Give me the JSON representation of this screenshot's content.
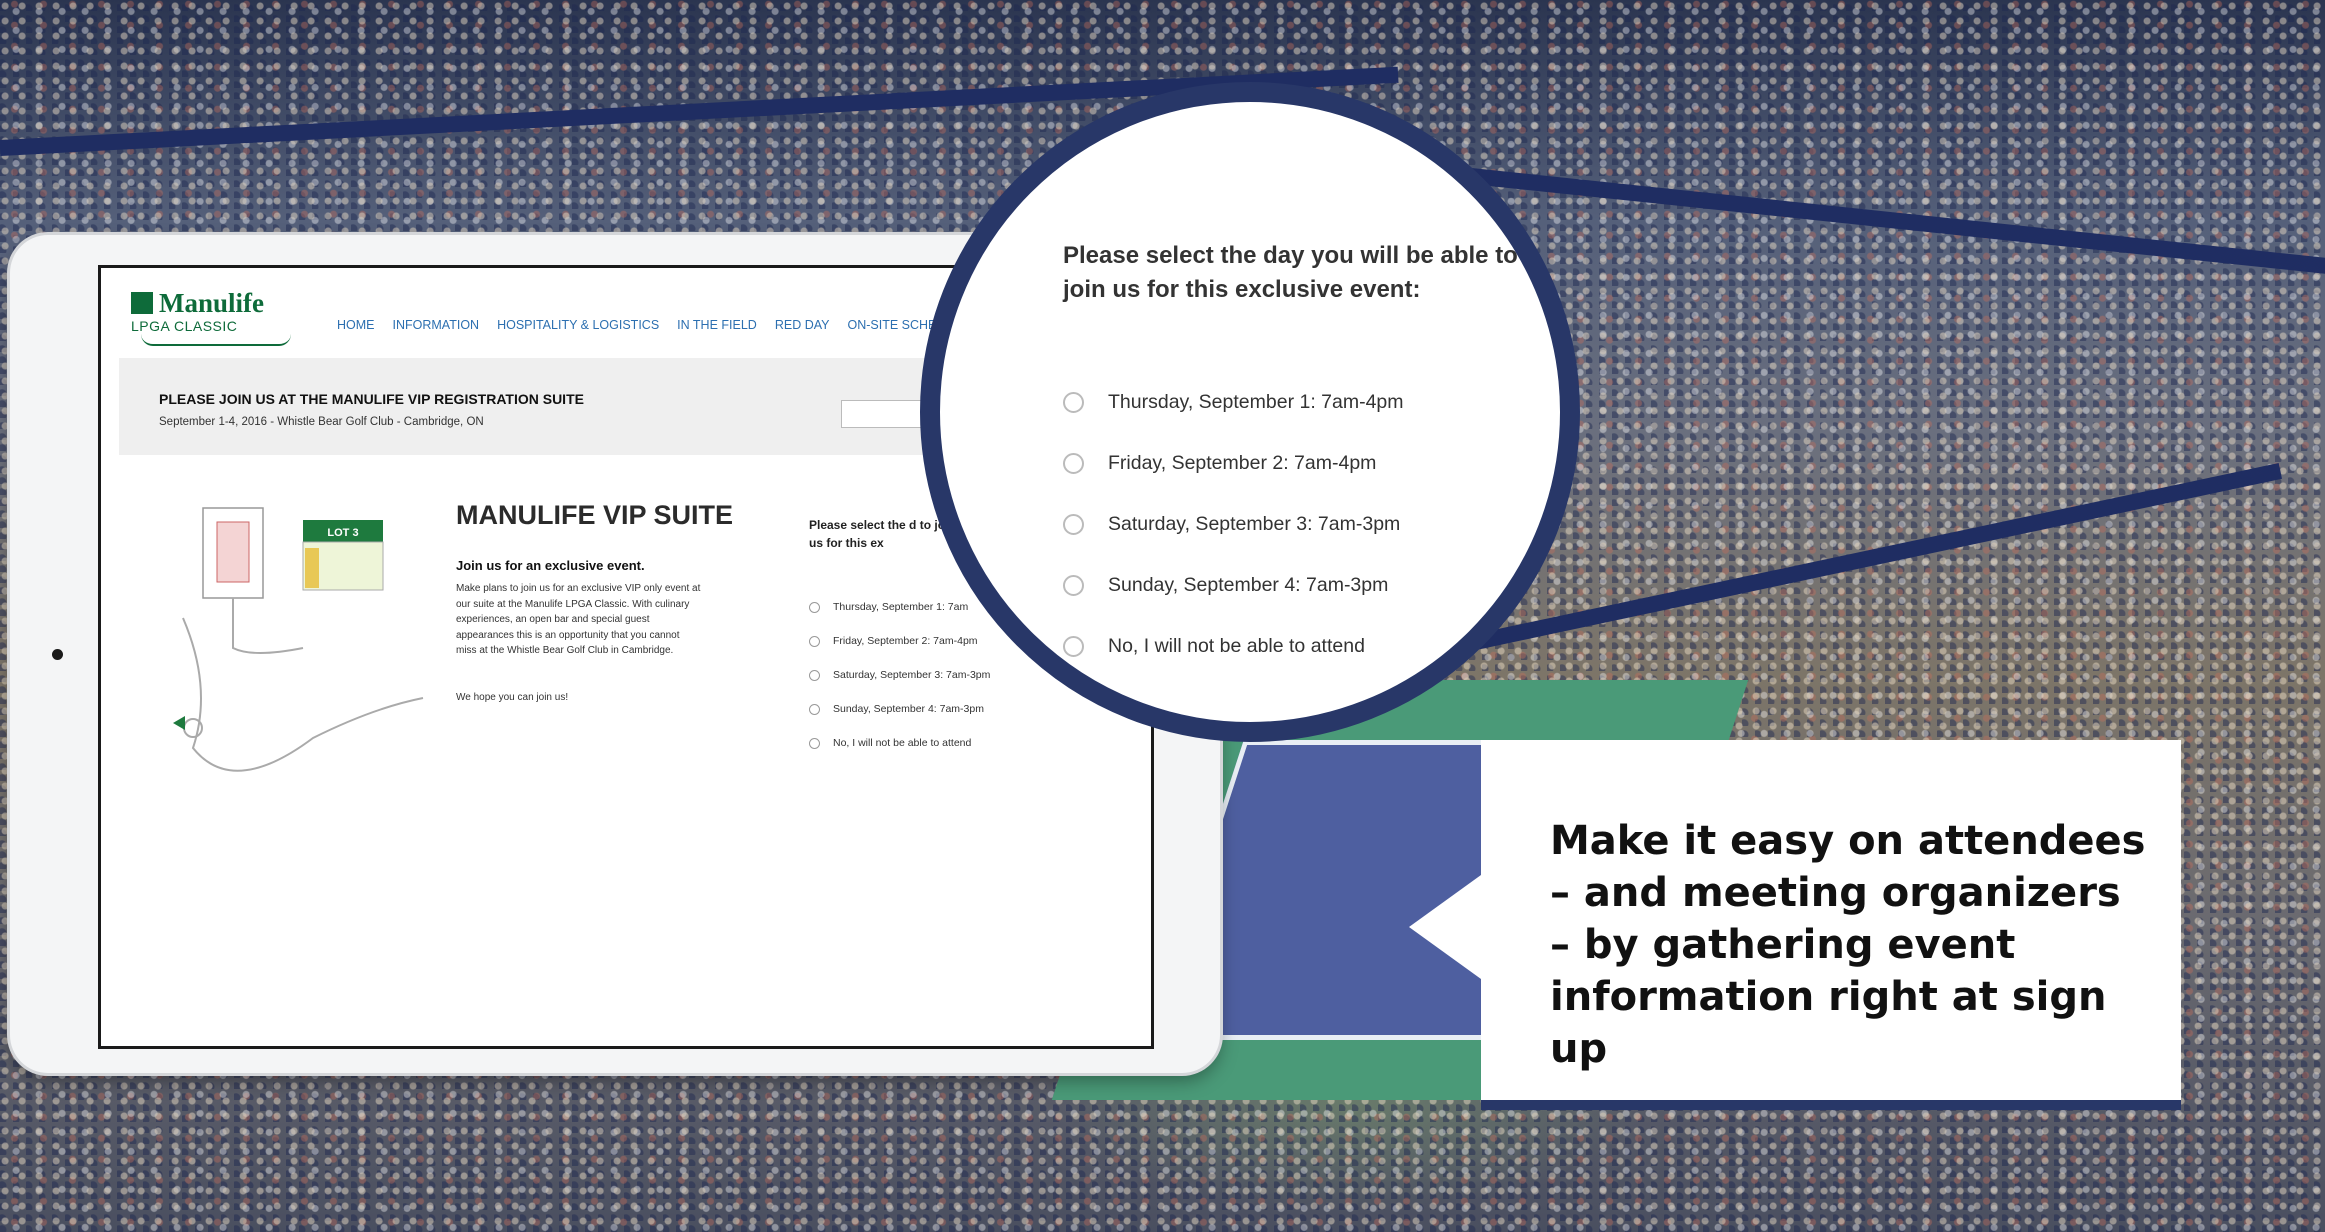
{
  "site": {
    "logo_brand": "Manulife",
    "logo_sub": "LPGA CLASSIC",
    "nav": [
      "HOME",
      "INFORMATION",
      "HOSPITALITY & LOGISTICS",
      "IN THE FIELD",
      "RED DAY",
      "ON-SITE SCHE"
    ],
    "banner_title": "PLEASE JOIN US AT THE MANULIFE VIP REGISTRATION SUITE",
    "banner_subtitle": "September 1-4, 2016 - Whistle Bear Golf Club - Cambridge, ON",
    "map_label_lot": "LOT 3",
    "vip_title": "MANULIFE VIP SUITE",
    "join_heading": "Join us for an exclusive event.",
    "join_body": "Make plans to join us for an exclusive VIP only event at our suite at the Manulife LPGA Classic. With culinary experiences, an open bar and special guest appearances this is an opportunity that you cannot miss at the Whistle Bear Golf Club in Cambridge.",
    "join_close": "We hope you can join us!",
    "form_question": "Please select the day you will be able to join us for this exclusive event:",
    "form_question_small": "Please select the d to join us for this ex",
    "options": [
      "Thursday, September 1: 7am-4pm",
      "Friday, September 2: 7am-4pm",
      "Saturday, September 3: 7am-3pm",
      "Sunday, September 4: 7am-3pm",
      "No, I will not be able to attend"
    ],
    "options_small": [
      "Thursday, September 1: 7am",
      "Friday, September 2: 7am-4pm",
      "Saturday, September 3: 7am-3pm",
      "Sunday, September 4: 7am-3pm",
      "No, I will not be able to attend"
    ]
  },
  "callout": {
    "bold": "Make it easy",
    "rest": " on attendees – and meeting organizers – by gathering event information right at sign up"
  },
  "colors": {
    "navy": "#283768",
    "manulife_green": "#0e6b3a",
    "nav_link": "#2c6fb0"
  }
}
